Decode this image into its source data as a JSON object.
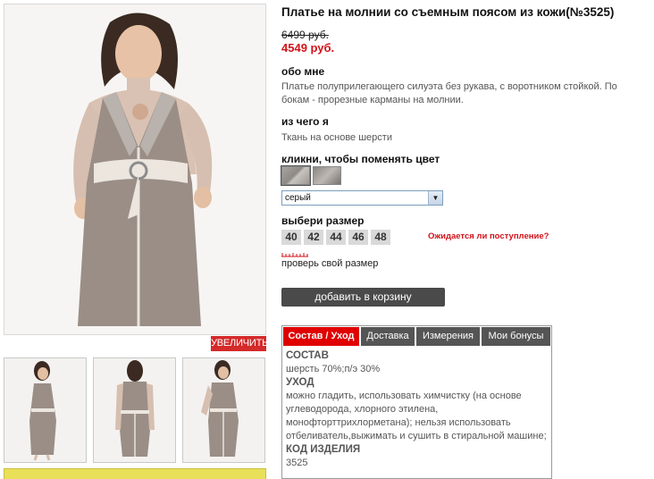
{
  "product": {
    "title": "Платье на молнии со съемным поясом из кожи(№3525)",
    "old_price": "6499 руб.",
    "new_price": "4549 руб."
  },
  "gallery": {
    "zoom_label": "УВЕЛИЧИТЬ"
  },
  "about": {
    "heading": "обо мне",
    "text": "Платье полуприлегающего силуэта без рукава, с воротником стойкой. По бокам - прорезные карманы на молнии."
  },
  "material": {
    "heading": "из чего я",
    "text": "Ткань на основе шерсти"
  },
  "color": {
    "heading": "кликни, чтобы поменять цвет",
    "selected": "серый"
  },
  "size": {
    "heading": "выбери размер",
    "options": [
      "40",
      "42",
      "44",
      "46",
      "48"
    ],
    "availability_link": "Ожидается ли поступление?",
    "check_size_link": "проверь свой размер"
  },
  "cart": {
    "button_label": "добавить в корзину"
  },
  "tabs": {
    "items": [
      "Состав / Уход",
      "Доставка",
      "Измерения",
      "Мои бонусы"
    ],
    "active_index": 0
  },
  "composition": {
    "heading1": "СОСТАВ",
    "text1": "шерсть 70%;п/э 30%",
    "heading2": "УХОД",
    "text2": "можно гладить, использовать химчистку (на основе углеводорода, хлорного этилена, монофторттрихлорметана); нельзя использовать отбеливатель,выжимать и сушить в стиральной машине;",
    "heading3": "КОД ИЗДЕЛИЯ",
    "text3": "3525"
  },
  "colors": {
    "price_red": "#d2121a",
    "tab_active": "#e00000",
    "tab_inactive": "#555555",
    "button_dark": "#4a4a4a"
  }
}
